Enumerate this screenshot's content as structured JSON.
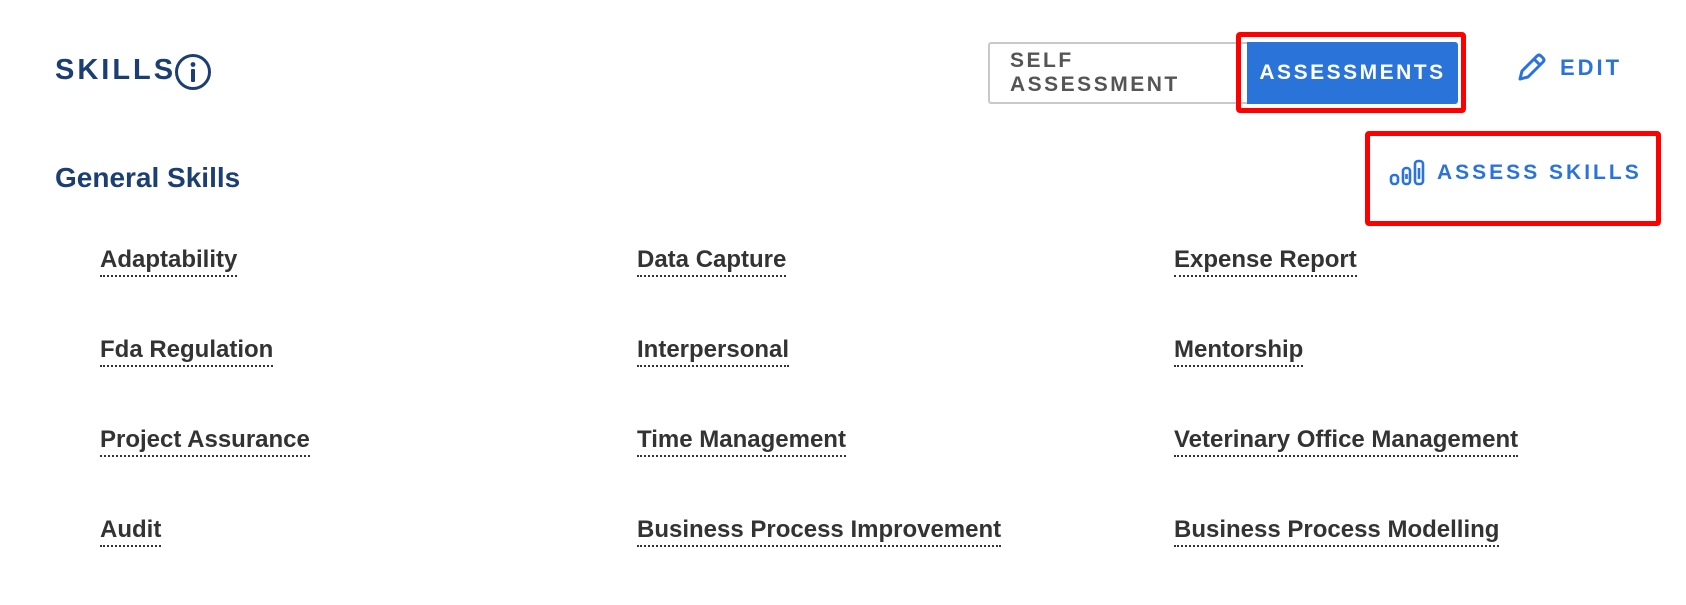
{
  "header": {
    "title": "SKILLS",
    "info_icon": "info-circle-icon"
  },
  "toggle": {
    "self_assessment_label": "SELF ASSESSMENT",
    "assessments_label": "ASSESSMENTS",
    "active": "ASSESSMENTS"
  },
  "edit": {
    "label": "EDIT",
    "icon": "pencil-icon"
  },
  "section": {
    "title": "General Skills"
  },
  "assess_skills": {
    "label": "ASSESS SKILLS",
    "icon": "bar-chart-icon"
  },
  "skills": [
    "Adaptability",
    "Data Capture",
    "Expense Report",
    "Fda Regulation",
    "Interpersonal",
    "Mentorship",
    "Project Assurance",
    "Time Management",
    "Veterinary Office Management",
    "Audit",
    "Business Process Improvement",
    "Business Process Modelling"
  ],
  "colors": {
    "title": "#1c3f73",
    "accent": "#2a73d9",
    "highlight": "#ff0000",
    "text": "#333333"
  }
}
